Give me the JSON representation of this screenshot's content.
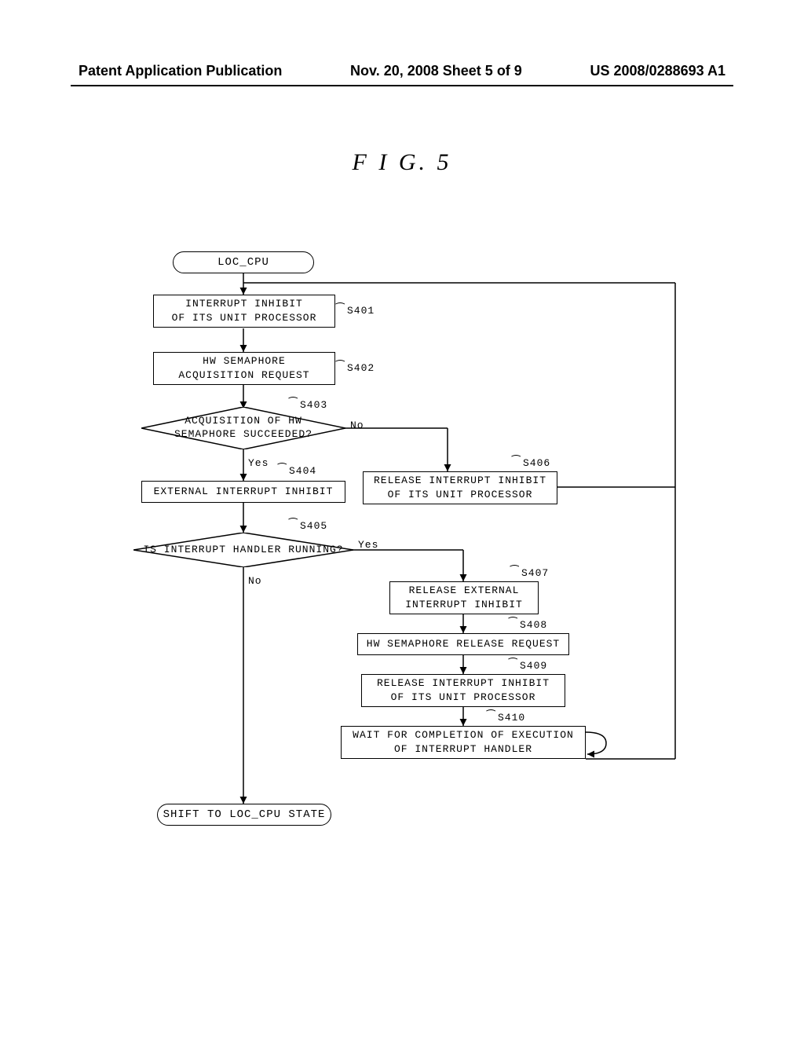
{
  "header": {
    "left": "Patent Application Publication",
    "center": "Nov. 20, 2008  Sheet 5 of 9",
    "right": "US 2008/0288693 A1"
  },
  "figure_title": "F I G. 5",
  "nodes": {
    "start": "LOC_CPU",
    "s401": "INTERRUPT INHIBIT\nOF ITS UNIT PROCESSOR",
    "s402": "HW SEMAPHORE\nACQUISITION REQUEST",
    "s403": "ACQUISITION OF HW\nSEMAPHORE SUCCEEDED?",
    "s404": "EXTERNAL INTERRUPT INHIBIT",
    "s405": "IS INTERRUPT HANDLER RUNNING?",
    "s406": "RELEASE INTERRUPT INHIBIT\nOF ITS UNIT PROCESSOR",
    "s407": "RELEASE EXTERNAL\nINTERRUPT INHIBIT",
    "s408": "HW SEMAPHORE RELEASE REQUEST",
    "s409": "RELEASE INTERRUPT INHIBIT\nOF ITS UNIT PROCESSOR",
    "s410": "WAIT FOR COMPLETION OF EXECUTION\nOF INTERRUPT HANDLER",
    "end": "SHIFT TO LOC_CPU STATE"
  },
  "steps": {
    "s401": "S401",
    "s402": "S402",
    "s403": "S403",
    "s404": "S404",
    "s405": "S405",
    "s406": "S406",
    "s407": "S407",
    "s408": "S408",
    "s409": "S409",
    "s410": "S410"
  },
  "labels": {
    "yes": "Yes",
    "no": "No",
    "yes2": "Yes",
    "no2": "No"
  },
  "chart_data": {
    "type": "flowchart",
    "title": "FIG. 5",
    "nodes": [
      {
        "id": "start",
        "type": "terminator",
        "label": "LOC_CPU"
      },
      {
        "id": "S401",
        "type": "process",
        "label": "INTERRUPT INHIBIT OF ITS UNIT PROCESSOR"
      },
      {
        "id": "S402",
        "type": "process",
        "label": "HW SEMAPHORE ACQUISITION REQUEST"
      },
      {
        "id": "S403",
        "type": "decision",
        "label": "ACQUISITION OF HW SEMAPHORE SUCCEEDED?"
      },
      {
        "id": "S404",
        "type": "process",
        "label": "EXTERNAL INTERRUPT INHIBIT"
      },
      {
        "id": "S405",
        "type": "decision",
        "label": "IS INTERRUPT HANDLER RUNNING?"
      },
      {
        "id": "S406",
        "type": "process",
        "label": "RELEASE INTERRUPT INHIBIT OF ITS UNIT PROCESSOR"
      },
      {
        "id": "S407",
        "type": "process",
        "label": "RELEASE EXTERNAL INTERRUPT INHIBIT"
      },
      {
        "id": "S408",
        "type": "process",
        "label": "HW SEMAPHORE RELEASE REQUEST"
      },
      {
        "id": "S409",
        "type": "process",
        "label": "RELEASE INTERRUPT INHIBIT OF ITS UNIT PROCESSOR"
      },
      {
        "id": "S410",
        "type": "process",
        "label": "WAIT FOR COMPLETION OF EXECUTION OF INTERRUPT HANDLER"
      },
      {
        "id": "end",
        "type": "terminator",
        "label": "SHIFT TO LOC_CPU STATE"
      }
    ],
    "edges": [
      {
        "from": "start",
        "to": "S401"
      },
      {
        "from": "S401",
        "to": "S402"
      },
      {
        "from": "S402",
        "to": "S403"
      },
      {
        "from": "S403",
        "to": "S404",
        "label": "Yes"
      },
      {
        "from": "S403",
        "to": "S406",
        "label": "No"
      },
      {
        "from": "S404",
        "to": "S405"
      },
      {
        "from": "S405",
        "to": "end",
        "label": "No"
      },
      {
        "from": "S405",
        "to": "S407",
        "label": "Yes"
      },
      {
        "from": "S406",
        "to": "S401",
        "note": "loop back"
      },
      {
        "from": "S407",
        "to": "S408"
      },
      {
        "from": "S408",
        "to": "S409"
      },
      {
        "from": "S409",
        "to": "S410"
      },
      {
        "from": "S410",
        "to": "S410",
        "note": "self-loop"
      },
      {
        "from": "S410",
        "to": "S401",
        "note": "loop back"
      }
    ]
  }
}
